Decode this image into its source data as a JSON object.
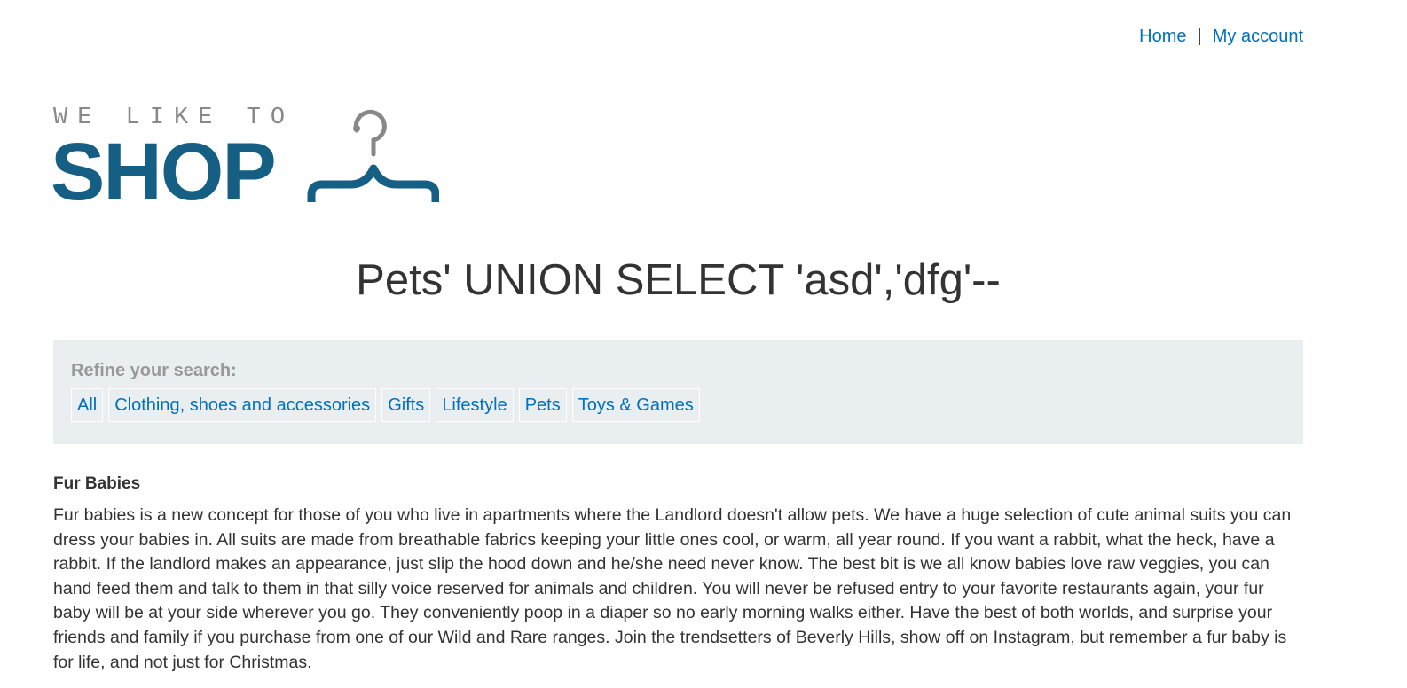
{
  "nav": {
    "home_label": "Home",
    "separator": "|",
    "account_label": "My account"
  },
  "logo": {
    "tagline": "WE LIKE TO",
    "wordmark": "SHOP",
    "icon": "hanger-icon",
    "colors": {
      "wordmark": "#155f84",
      "tagline": "#888888"
    }
  },
  "page_title": "Pets' UNION SELECT 'asd','dfg'--",
  "filters": {
    "label": "Refine your search:",
    "items": [
      "All",
      "Clothing, shoes and accessories",
      "Gifts",
      "Lifestyle",
      "Pets",
      "Toys & Games"
    ]
  },
  "product": {
    "name": "Fur Babies",
    "description": "Fur babies is a new concept for those of you who live in apartments where the Landlord doesn't allow pets. We have a huge selection of cute animal suits you can dress your babies in. All suits are made from breathable fabrics keeping your little ones cool, or warm, all year round. If you want a rabbit, what the heck, have a rabbit. If the landlord makes an appearance, just slip the hood down and he/she need never know. The best bit is we all know babies love raw veggies, you can hand feed them and talk to them in that silly voice reserved for animals and children. You will never be refused entry to your favorite restaurants again, your fur baby will be at your side wherever you go. They conveniently poop in a diaper so no early morning walks either. Have the best of both worlds, and surprise your friends and family if you purchase from one of our Wild and Rare ranges. Join the trendsetters of Beverly Hills, show off on Instagram, but remember a fur baby is for life, and not just for Christmas."
  },
  "colors": {
    "link": "#0071bc",
    "text": "#333333",
    "filter_bg": "#e9eef0"
  }
}
